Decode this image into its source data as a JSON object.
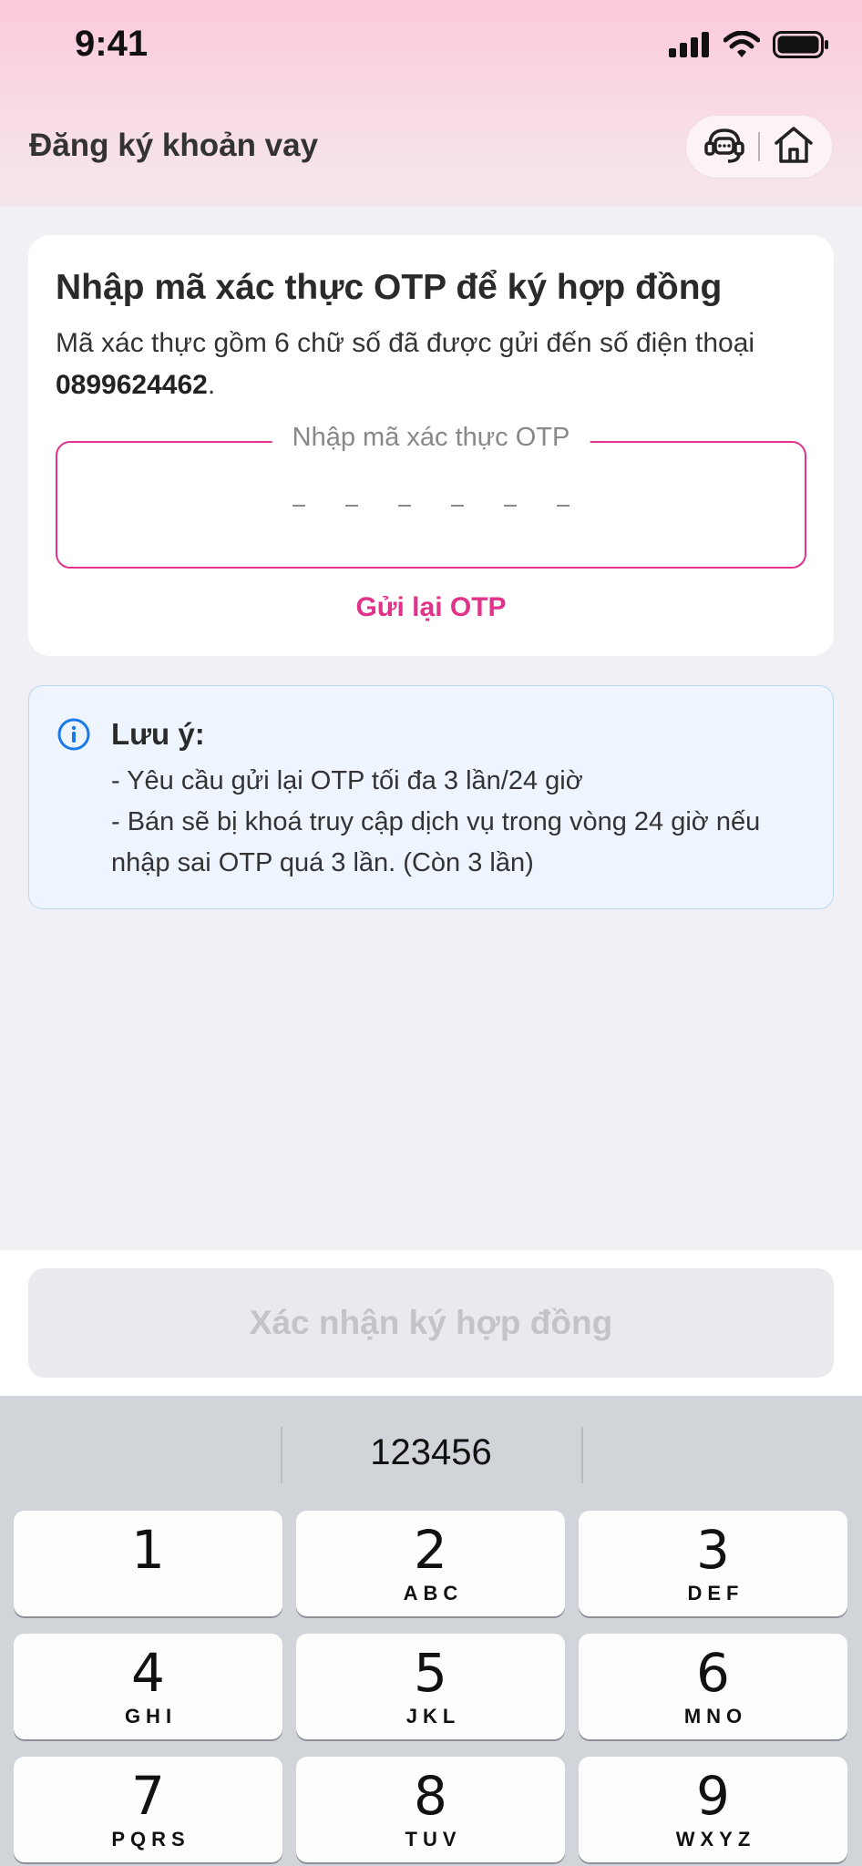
{
  "status_bar": {
    "time": "9:41",
    "icons": [
      "signal-icon",
      "wifi-icon",
      "battery-icon"
    ]
  },
  "header": {
    "title": "Đăng ký khoản vay",
    "actions": [
      "support-agent-icon",
      "home-icon"
    ]
  },
  "otp_card": {
    "title": "Nhập mã xác thực OTP để ký hợp đồng",
    "description": "Mã xác thực gồm 6 chữ số đã được gửi đến số điện thoại",
    "phone": "0899624462",
    "phone_suffix": ".",
    "input_label": "Nhập mã xác thực OTP",
    "input_value": "",
    "digits": 6,
    "resend_label": "Gửi lại OTP"
  },
  "note": {
    "title": "Lưu ý:",
    "line1": "- Yêu cầu gửi lại OTP tối đa 3 lần/24 giờ",
    "line2": "- Bán sẽ bị khoá truy cập dịch vụ trong vòng 24 giờ nếu nhập sai OTP quá 3 lần. (Còn 3 lần)"
  },
  "confirm_button": {
    "label": "Xác nhận ký hợp đồng",
    "enabled": false
  },
  "keyboard": {
    "suggestion": "123456",
    "keys": [
      {
        "num": "1",
        "letters": ""
      },
      {
        "num": "2",
        "letters": "ABC"
      },
      {
        "num": "3",
        "letters": "DEF"
      },
      {
        "num": "4",
        "letters": "GHI"
      },
      {
        "num": "5",
        "letters": "JKL"
      },
      {
        "num": "6",
        "letters": "MNO"
      },
      {
        "num": "7",
        "letters": "PQRS"
      },
      {
        "num": "8",
        "letters": "TUV"
      },
      {
        "num": "9",
        "letters": "WXYZ"
      }
    ]
  },
  "colors": {
    "accent": "#e0338a",
    "info": "#1a7ae8",
    "note_bg": "#eef5fe"
  }
}
